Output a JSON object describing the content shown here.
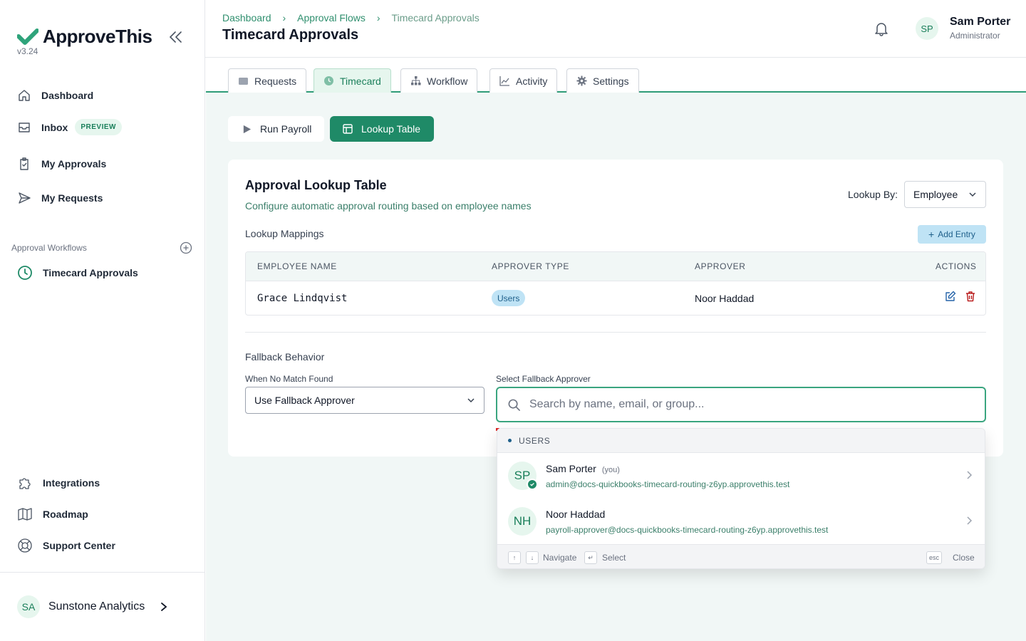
{
  "app": {
    "name": "ApproveThis",
    "version": "v3.24"
  },
  "sidebar": {
    "items": [
      {
        "label": "Dashboard"
      },
      {
        "label": "Inbox",
        "badge": "PREVIEW"
      },
      {
        "label": "My Approvals"
      },
      {
        "label": "My Requests"
      }
    ],
    "workflows_label": "Approval Workflows",
    "workflows": [
      {
        "label": "Timecard Approvals"
      }
    ],
    "bottom_items": [
      {
        "label": "Integrations"
      },
      {
        "label": "Roadmap"
      },
      {
        "label": "Support Center"
      }
    ],
    "org": {
      "initials": "SA",
      "name": "Sunstone Analytics"
    }
  },
  "header": {
    "breadcrumbs": [
      "Dashboard",
      "Approval Flows",
      "Timecard Approvals"
    ],
    "title": "Timecard Approvals",
    "user": {
      "initials": "SP",
      "name": "Sam Porter",
      "role": "Administrator"
    }
  },
  "tabs": [
    {
      "label": "Requests"
    },
    {
      "label": "Timecard",
      "active": true
    },
    {
      "label": "Workflow"
    },
    {
      "label": "Activity"
    },
    {
      "label": "Settings"
    }
  ],
  "actions": {
    "run_payroll": "Run Payroll",
    "lookup_table": "Lookup Table"
  },
  "card": {
    "title": "Approval Lookup Table",
    "subtitle": "Configure automatic approval routing based on employee names",
    "lookup_by_label": "Lookup By:",
    "lookup_by_value": "Employee",
    "mappings_label": "Lookup Mappings",
    "add_entry": "Add Entry",
    "table": {
      "headers": [
        "EMPLOYEE NAME",
        "APPROVER TYPE",
        "APPROVER",
        "ACTIONS"
      ],
      "rows": [
        {
          "employee": "Grace Lindqvist",
          "type": "Users",
          "approver": "Noor Haddad"
        }
      ]
    },
    "fallback": {
      "title": "Fallback Behavior",
      "no_match_label": "When No Match Found",
      "no_match_value": "Use Fallback Approver",
      "approver_label": "Select Fallback Approver",
      "search_placeholder": "Search by name, email, or group..."
    }
  },
  "dropdown": {
    "section": "USERS",
    "options": [
      {
        "initials": "SP",
        "name": "Sam Porter",
        "you": "(you)",
        "email": "admin@docs-quickbooks-timecard-routing-z6yp.approvethis.test"
      },
      {
        "initials": "NH",
        "name": "Noor Haddad",
        "email": "payroll-approver@docs-quickbooks-timecard-routing-z6yp.approvethis.test"
      }
    ],
    "footer": {
      "up_key": "↑",
      "down_key": "↓",
      "navigate": "Navigate",
      "enter_key": "↵",
      "select": "Select",
      "esc_key": "esc",
      "close": "Close"
    }
  },
  "colors": {
    "brand": "#1f8a67",
    "accent_light": "#e6f6ee",
    "info_bg": "#bfe3f5",
    "danger": "#dc2626"
  }
}
